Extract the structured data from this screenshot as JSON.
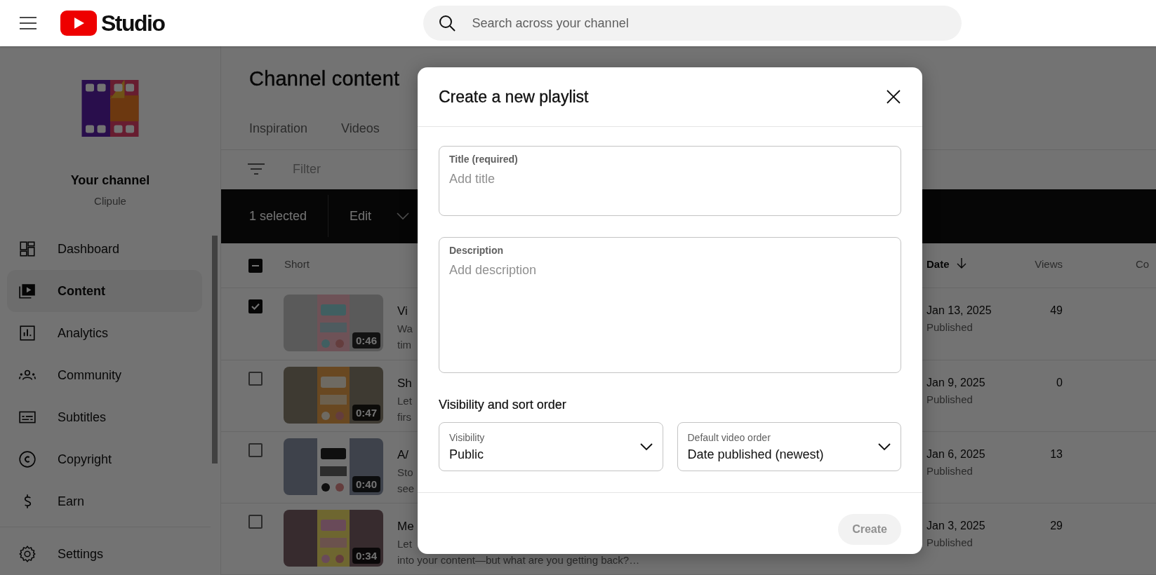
{
  "header": {
    "logo_text": "Studio",
    "search": {
      "placeholder": "Search across your channel"
    }
  },
  "sidebar": {
    "channel": {
      "name": "Your channel",
      "handle": "Clipule"
    },
    "items": [
      {
        "label": "Dashboard",
        "kind": "dashboard",
        "selected": false
      },
      {
        "label": "Content",
        "kind": "content",
        "selected": true
      },
      {
        "label": "Analytics",
        "kind": "analytics",
        "selected": false
      },
      {
        "label": "Community",
        "kind": "community",
        "selected": false
      },
      {
        "label": "Subtitles",
        "kind": "subtitles",
        "selected": false
      },
      {
        "label": "Copyright",
        "kind": "copyright",
        "selected": false
      },
      {
        "label": "Earn",
        "kind": "earn",
        "selected": false
      }
    ],
    "footer_items": [
      {
        "label": "Settings",
        "kind": "settings",
        "selected": false
      }
    ]
  },
  "main": {
    "title": "Channel content",
    "tabs": [
      {
        "label": "Inspiration",
        "selected": false
      },
      {
        "label": "Videos",
        "selected": false
      }
    ],
    "filter": {
      "placeholder": "Filter"
    },
    "selection_bar": {
      "count": "1 selected",
      "action": "Edit"
    },
    "table": {
      "select_all": {
        "indeterminate": true
      },
      "columns": [
        {
          "label": "Short",
          "sorted": false
        },
        {
          "label": "Date",
          "sorted": true
        },
        {
          "label": "Views",
          "sorted": false
        },
        {
          "label": "Co",
          "sorted": false
        }
      ],
      "rows": [
        {
          "checked": true,
          "duration": "0:46",
          "title": "Vi",
          "description": [
            "Wa",
            "tim"
          ],
          "date": "Jan 13, 2025",
          "status": "Published",
          "views": "49"
        },
        {
          "checked": false,
          "duration": "0:47",
          "title": "Sh",
          "description": [
            "Let",
            "firs"
          ],
          "date": "Jan 9, 2025",
          "status": "Published",
          "views": "0"
        },
        {
          "checked": false,
          "duration": "0:40",
          "title": "A/",
          "description": [
            "Sto",
            "see"
          ],
          "date": "Jan 6, 2025",
          "status": "Published",
          "views": "13"
        },
        {
          "checked": false,
          "duration": "0:34",
          "title": "Me",
          "description": [
            "Let",
            "into your content—but what are you getting back?…"
          ],
          "date": "Jan 3, 2025",
          "status": "Published",
          "views": "29"
        }
      ]
    }
  },
  "dialog": {
    "title": "Create a new playlist",
    "fields": [
      {
        "kind": "text",
        "label": "Title (required)",
        "placeholder": "Add title"
      },
      {
        "kind": "textarea",
        "label": "Description",
        "placeholder": "Add description"
      }
    ],
    "section_title": "Visibility and sort order",
    "selects": [
      {
        "label": "Visibility",
        "value": "Public"
      },
      {
        "label": "Default video order",
        "value": "Date published (newest)"
      }
    ],
    "create_button": {
      "label": "Create",
      "disabled": true
    }
  }
}
